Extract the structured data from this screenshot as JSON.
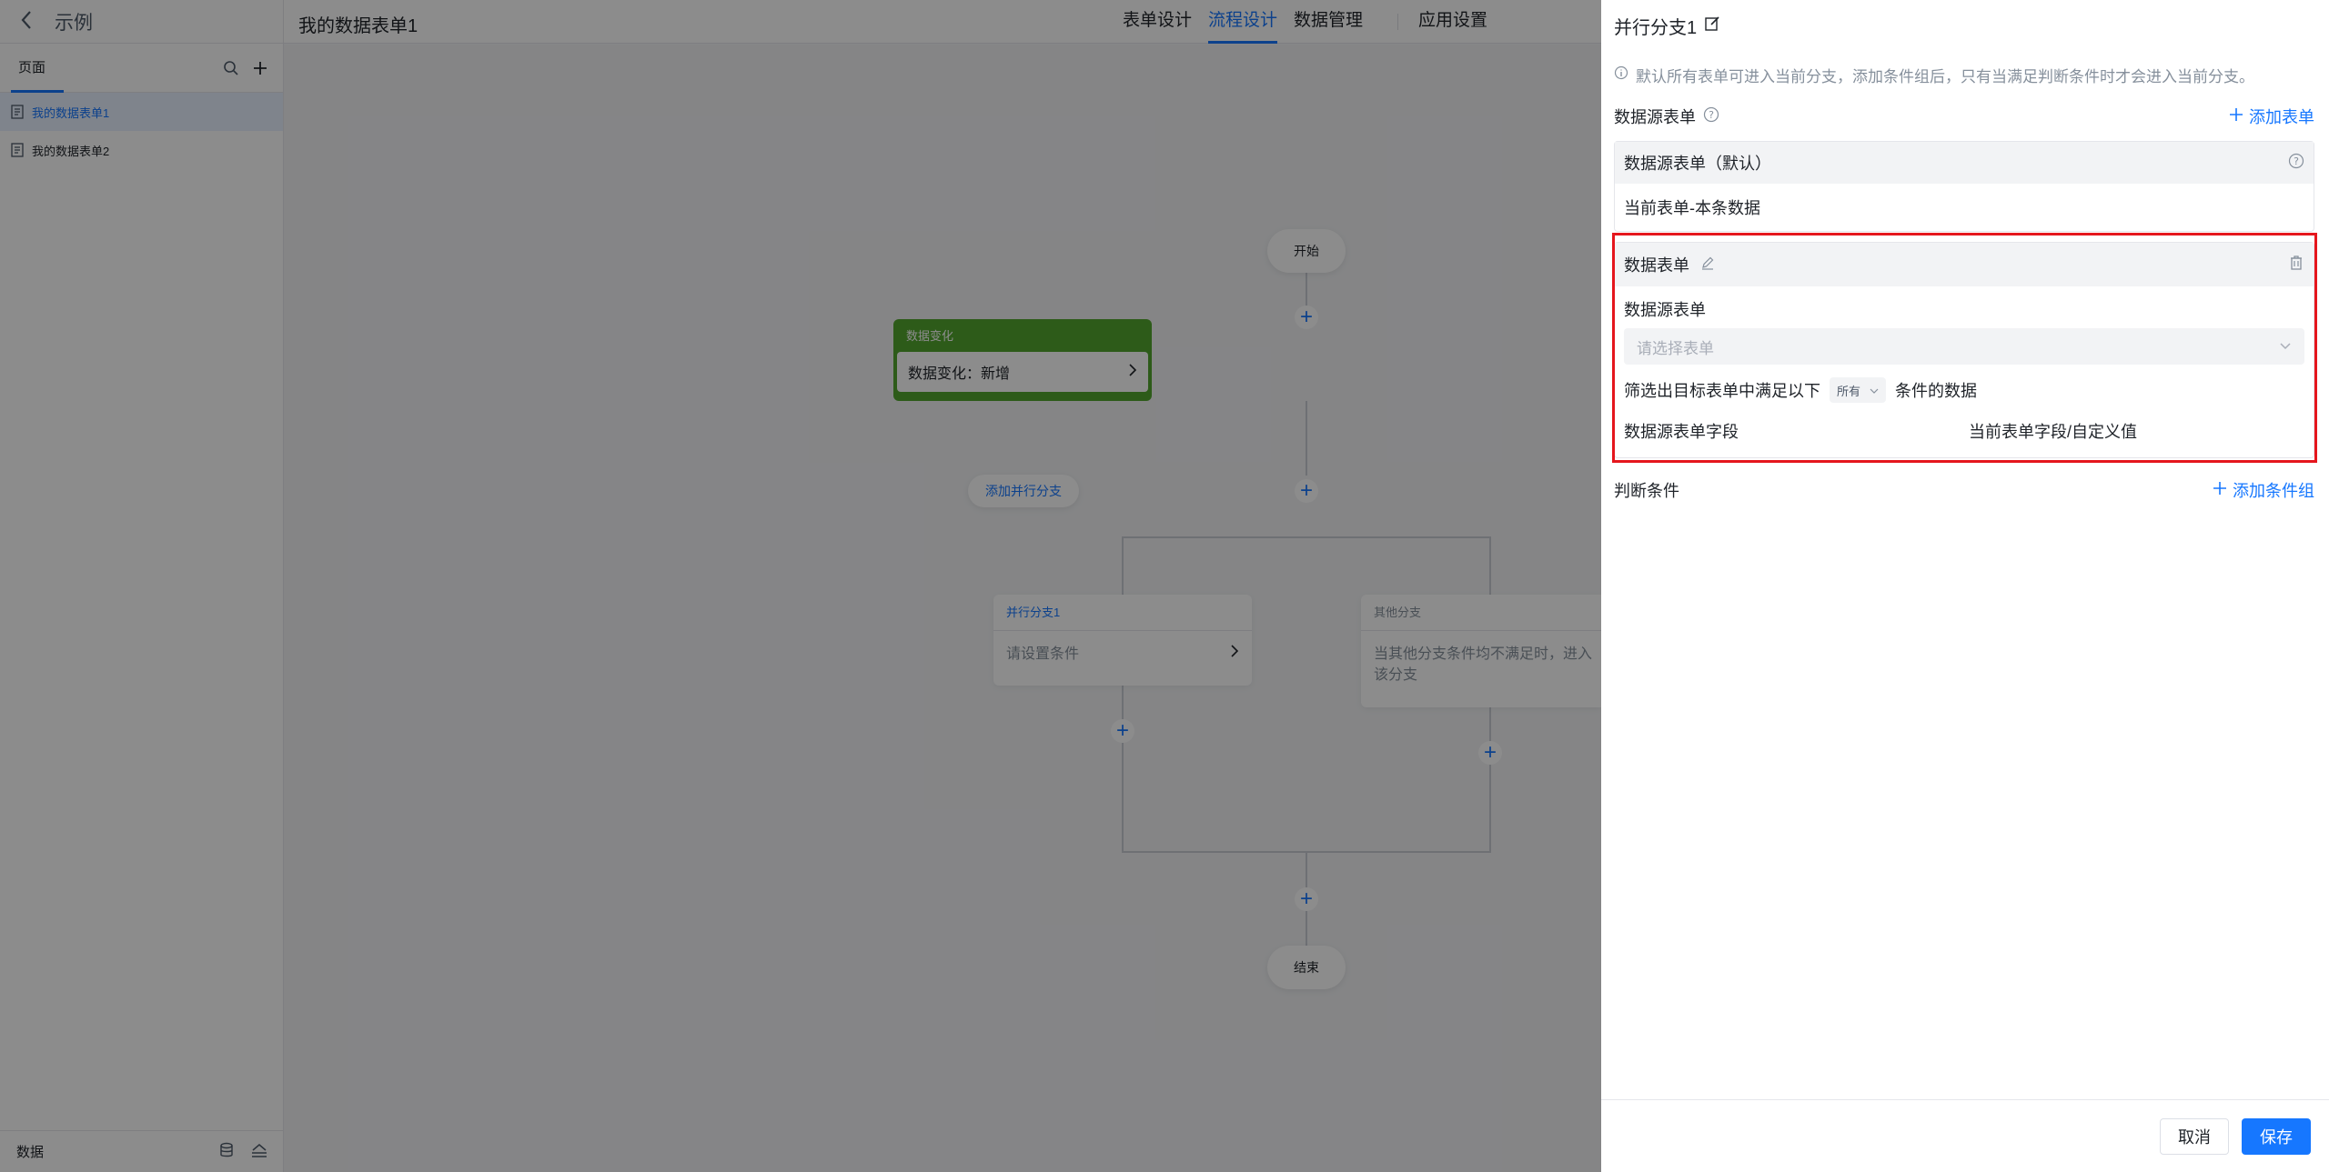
{
  "app": {
    "back_label": "示例"
  },
  "sidebar": {
    "tab_label": "页面",
    "items": [
      {
        "label": "我的数据表单1",
        "active": true
      },
      {
        "label": "我的数据表单2",
        "active": false
      }
    ],
    "footer_label": "数据"
  },
  "topbar": {
    "title": "我的数据表单1",
    "nav": [
      {
        "label": "表单设计"
      },
      {
        "label": "流程设计",
        "active": true
      },
      {
        "label": "数据管理"
      },
      {
        "label": "应用设置"
      }
    ]
  },
  "flow": {
    "start_label": "开始",
    "trigger_title": "数据变化",
    "trigger_body": "数据变化：新增",
    "add_branch_label": "添加并行分支",
    "branch1_title": "并行分支1",
    "branch1_body": "请设置条件",
    "branch2_title": "其他分支",
    "branch2_body": "当其他分支条件均不满足时，进入该分支",
    "end_label": "结束"
  },
  "drawer": {
    "title": "并行分支1",
    "tip": "默认所有表单可进入当前分支，添加条件组后，只有当满足判断条件时才会进入当前分支。",
    "datasource_label": "数据源表单",
    "add_form_label": "添加表单",
    "default_box_title": "数据源表单（默认）",
    "default_box_value": "当前表单-本条数据",
    "table_box_title": "数据表单",
    "table_box_field_label": "数据源表单",
    "table_box_placeholder": "请选择表单",
    "filter_prefix": "筛选出目标表单中满足以下",
    "filter_mode": "所有",
    "filter_suffix": "条件的数据",
    "col_left": "数据源表单字段",
    "col_right": "当前表单字段/自定义值",
    "condition_label": "判断条件",
    "add_condition_group_label": "添加条件组",
    "cancel_label": "取消",
    "save_label": "保存"
  },
  "colors": {
    "accent": "#1677ff",
    "trigger": "#52a62f",
    "highlight": "#e5161d"
  }
}
